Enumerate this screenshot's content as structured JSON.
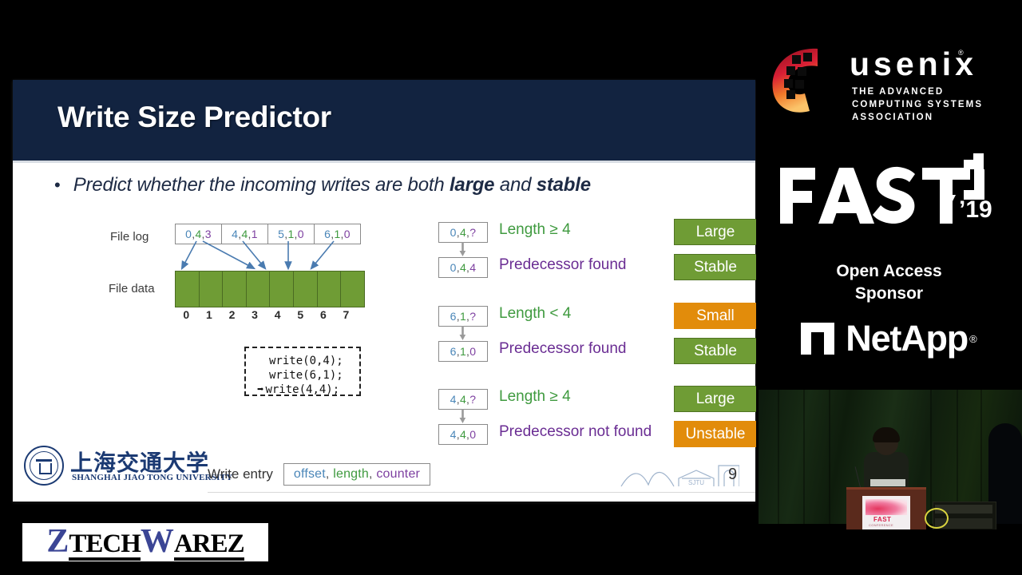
{
  "slide": {
    "title": "Write Size Predictor",
    "bullet": {
      "dot": "•",
      "prefix": "Predict whether the incoming writes are both ",
      "bold1": "large",
      "middle": " and ",
      "bold2": "stable"
    },
    "diagram": {
      "filelog_label": "File log",
      "filedata_label": "File data",
      "log_entries": [
        {
          "offset": "0",
          "length": "4",
          "counter": "3"
        },
        {
          "offset": "4",
          "length": "4",
          "counter": "1"
        },
        {
          "offset": "5",
          "length": "1",
          "counter": "0"
        },
        {
          "offset": "6",
          "length": "1",
          "counter": "0"
        }
      ],
      "block_indices": [
        "0",
        "1",
        "2",
        "3",
        "4",
        "5",
        "6",
        "7"
      ],
      "block_count": 8,
      "block_color": "#6f9c35"
    },
    "code_box": {
      "lines": [
        "write(0,4);",
        "write(6,1);",
        "write(4,4);"
      ],
      "current_line_index": 2,
      "cursor_glyph": "➡"
    },
    "predictions": [
      {
        "entry_before": {
          "offset": "0",
          "length": "4",
          "counter": "?"
        },
        "entry_after": {
          "offset": "0",
          "length": "4",
          "counter": "4"
        },
        "condition": "Length ≥ 4",
        "result": "Predecessor found",
        "badge_size": "Large",
        "badge_size_color": "#6f9c35",
        "badge_stability": "Stable",
        "badge_stability_color": "#6f9c35"
      },
      {
        "entry_before": {
          "offset": "6",
          "length": "1",
          "counter": "?"
        },
        "entry_after": {
          "offset": "6",
          "length": "1",
          "counter": "0"
        },
        "condition": "Length < 4",
        "result": "Predecessor found",
        "badge_size": "Small",
        "badge_size_color": "#e28c0b",
        "badge_stability": "Stable",
        "badge_stability_color": "#6f9c35"
      },
      {
        "entry_before": {
          "offset": "4",
          "length": "4",
          "counter": "?"
        },
        "entry_after": {
          "offset": "4",
          "length": "4",
          "counter": "0"
        },
        "condition": "Length ≥ 4",
        "result": "Predecessor not found",
        "badge_size": "Large",
        "badge_size_color": "#6f9c35",
        "badge_stability": "Unstable",
        "badge_stability_color": "#e28c0b"
      }
    ],
    "footer": {
      "university_cn": "上海交通大学",
      "university_en": "SHANGHAI JIAO TONG UNIVERSITY",
      "legend_label": "Write entry",
      "legend_offset": "offset",
      "legend_length": "length",
      "legend_counter": "counter",
      "slide_number": "9",
      "skyline_caption": "SJTU"
    },
    "colors": {
      "title_band": "#122340",
      "offset": "#4a86b8",
      "length": "#3f9a3f",
      "counter": "#7d3fa0",
      "condition": "#3f9a3f",
      "result": "#6a2d93"
    }
  },
  "rail": {
    "usenix_word": "usenix",
    "usenix_reg": "®",
    "usenix_sub1": "THE ADVANCED",
    "usenix_sub2": "COMPUTING SYSTEMS",
    "usenix_sub3": "ASSOCIATION",
    "fast_word": "FAST",
    "fast_year": "’19",
    "sponsor_line1": "Open Access",
    "sponsor_line2": "Sponsor",
    "netapp_word": "NetApp",
    "netapp_reg": "®"
  },
  "watermark": {
    "z": "Z",
    "tech": "TECH",
    "w": "W",
    "arez": "AREZ"
  }
}
